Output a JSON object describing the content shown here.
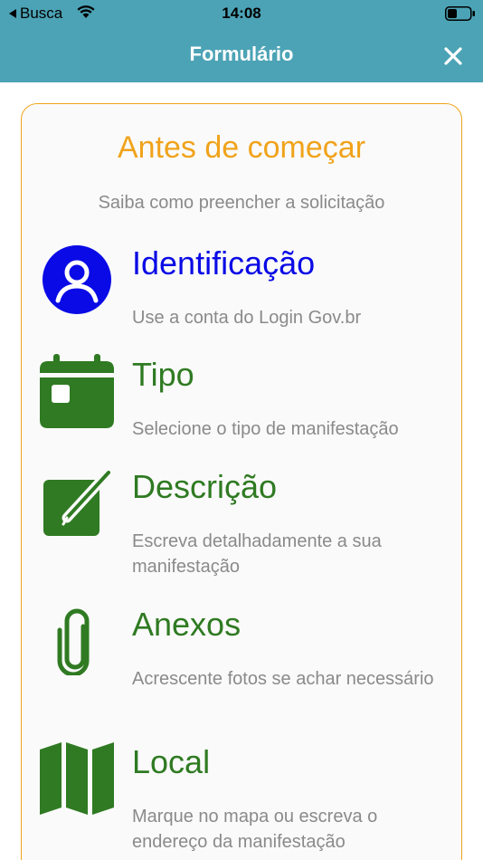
{
  "status_bar": {
    "back_label": "Busca",
    "time": "14:08"
  },
  "header": {
    "title": "Formulário"
  },
  "card": {
    "title": "Antes de começar",
    "subtitle": "Saiba como preencher a solicitação"
  },
  "items": [
    {
      "title": "Identificação",
      "description": "Use a conta do Login Gov.br",
      "icon": "user-circle-icon",
      "color": "#0a0ae6"
    },
    {
      "title": "Tipo",
      "description": "Selecione o tipo de manifestação",
      "icon": "calendar-icon",
      "color": "#2f7a22"
    },
    {
      "title": "Descrição",
      "description": "Escreva detalhadamente a sua manifestação",
      "icon": "edit-note-icon",
      "color": "#2f7a22"
    },
    {
      "title": "Anexos",
      "description": "Acrescente fotos se achar necessário",
      "icon": "paperclip-icon",
      "color": "#2f7a22"
    },
    {
      "title": "Local",
      "description": "Marque no mapa ou escreva o endereço da manifestação",
      "icon": "map-icon",
      "color": "#2f7a22"
    }
  ],
  "colors": {
    "header_bg": "#4ca3b6",
    "accent_orange": "#f0a31b",
    "blue": "#0a0ae6",
    "green": "#2f7a22",
    "gray_text": "#8a8a8a"
  }
}
